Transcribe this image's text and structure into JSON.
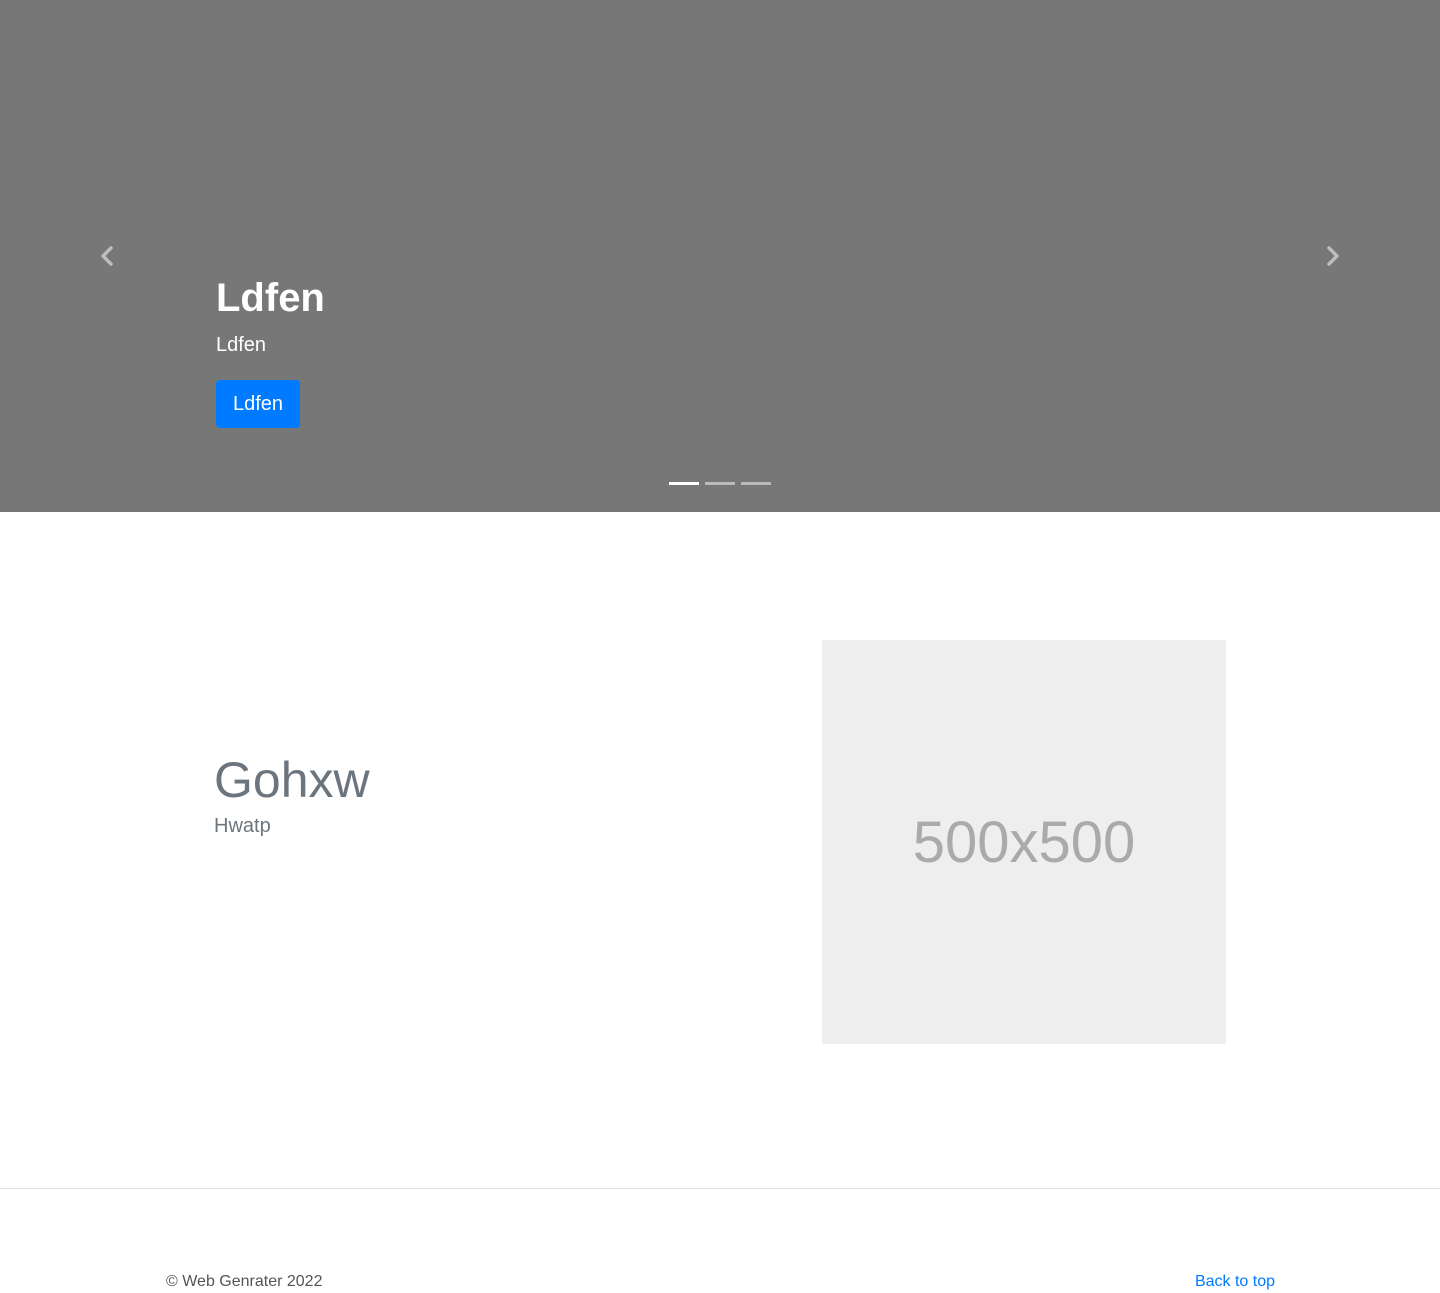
{
  "carousel": {
    "slide": {
      "title": "Ldfen",
      "subtitle": "Ldfen",
      "button_label": "Ldfen"
    },
    "indicators": [
      {
        "active": true
      },
      {
        "active": false
      },
      {
        "active": false
      }
    ],
    "prev_icon": "chevron-left-icon",
    "next_icon": "chevron-right-icon",
    "background_color": "#777777"
  },
  "feature": {
    "title": "Gohxw",
    "subtitle": "Hwatp",
    "image_placeholder": "500x500"
  },
  "footer": {
    "copyright": "© Web Genrater 2022",
    "back_to_top": "Back to top"
  },
  "colors": {
    "primary": "#007bff",
    "muted_text": "#6c757d",
    "placeholder_bg": "#eeeeee"
  }
}
